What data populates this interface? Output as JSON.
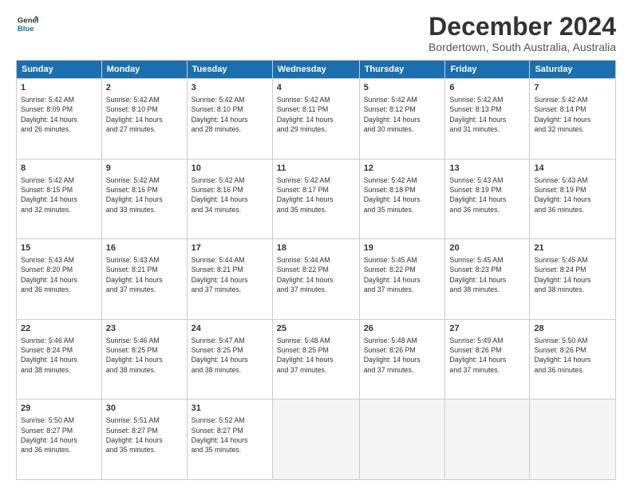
{
  "header": {
    "logo_line1": "General",
    "logo_line2": "Blue",
    "title": "December 2024",
    "subtitle": "Bordertown, South Australia, Australia"
  },
  "calendar": {
    "days_of_week": [
      "Sunday",
      "Monday",
      "Tuesday",
      "Wednesday",
      "Thursday",
      "Friday",
      "Saturday"
    ],
    "weeks": [
      [
        {
          "day": "",
          "empty": true
        },
        {
          "day": "",
          "empty": true
        },
        {
          "day": "",
          "empty": true
        },
        {
          "day": "",
          "empty": true
        },
        {
          "day": "",
          "empty": true
        },
        {
          "day": "",
          "empty": true
        },
        {
          "day": "7",
          "sunrise": "Sunrise: 5:42 AM",
          "sunset": "Sunset: 8:14 PM",
          "daylight": "Daylight: 14 hours and 32 minutes."
        }
      ],
      [
        {
          "day": "1",
          "sunrise": "Sunrise: 5:42 AM",
          "sunset": "Sunset: 8:09 PM",
          "daylight": "Daylight: 14 hours and 26 minutes."
        },
        {
          "day": "2",
          "sunrise": "Sunrise: 5:42 AM",
          "sunset": "Sunset: 8:10 PM",
          "daylight": "Daylight: 14 hours and 27 minutes."
        },
        {
          "day": "3",
          "sunrise": "Sunrise: 5:42 AM",
          "sunset": "Sunset: 8:10 PM",
          "daylight": "Daylight: 14 hours and 28 minutes."
        },
        {
          "day": "4",
          "sunrise": "Sunrise: 5:42 AM",
          "sunset": "Sunset: 8:11 PM",
          "daylight": "Daylight: 14 hours and 29 minutes."
        },
        {
          "day": "5",
          "sunrise": "Sunrise: 5:42 AM",
          "sunset": "Sunset: 8:12 PM",
          "daylight": "Daylight: 14 hours and 30 minutes."
        },
        {
          "day": "6",
          "sunrise": "Sunrise: 5:42 AM",
          "sunset": "Sunset: 8:13 PM",
          "daylight": "Daylight: 14 hours and 31 minutes."
        },
        {
          "day": "7",
          "sunrise": "Sunrise: 5:42 AM",
          "sunset": "Sunset: 8:14 PM",
          "daylight": "Daylight: 14 hours and 32 minutes."
        }
      ],
      [
        {
          "day": "8",
          "sunrise": "Sunrise: 5:42 AM",
          "sunset": "Sunset: 8:15 PM",
          "daylight": "Daylight: 14 hours and 32 minutes."
        },
        {
          "day": "9",
          "sunrise": "Sunrise: 5:42 AM",
          "sunset": "Sunset: 8:16 PM",
          "daylight": "Daylight: 14 hours and 33 minutes."
        },
        {
          "day": "10",
          "sunrise": "Sunrise: 5:42 AM",
          "sunset": "Sunset: 8:16 PM",
          "daylight": "Daylight: 14 hours and 34 minutes."
        },
        {
          "day": "11",
          "sunrise": "Sunrise: 5:42 AM",
          "sunset": "Sunset: 8:17 PM",
          "daylight": "Daylight: 14 hours and 35 minutes."
        },
        {
          "day": "12",
          "sunrise": "Sunrise: 5:42 AM",
          "sunset": "Sunset: 8:18 PM",
          "daylight": "Daylight: 14 hours and 35 minutes."
        },
        {
          "day": "13",
          "sunrise": "Sunrise: 5:43 AM",
          "sunset": "Sunset: 8:19 PM",
          "daylight": "Daylight: 14 hours and 36 minutes."
        },
        {
          "day": "14",
          "sunrise": "Sunrise: 5:43 AM",
          "sunset": "Sunset: 8:19 PM",
          "daylight": "Daylight: 14 hours and 36 minutes."
        }
      ],
      [
        {
          "day": "15",
          "sunrise": "Sunrise: 5:43 AM",
          "sunset": "Sunset: 8:20 PM",
          "daylight": "Daylight: 14 hours and 36 minutes."
        },
        {
          "day": "16",
          "sunrise": "Sunrise: 5:43 AM",
          "sunset": "Sunset: 8:21 PM",
          "daylight": "Daylight: 14 hours and 37 minutes."
        },
        {
          "day": "17",
          "sunrise": "Sunrise: 5:44 AM",
          "sunset": "Sunset: 8:21 PM",
          "daylight": "Daylight: 14 hours and 37 minutes."
        },
        {
          "day": "18",
          "sunrise": "Sunrise: 5:44 AM",
          "sunset": "Sunset: 8:22 PM",
          "daylight": "Daylight: 14 hours and 37 minutes."
        },
        {
          "day": "19",
          "sunrise": "Sunrise: 5:45 AM",
          "sunset": "Sunset: 8:22 PM",
          "daylight": "Daylight: 14 hours and 37 minutes."
        },
        {
          "day": "20",
          "sunrise": "Sunrise: 5:45 AM",
          "sunset": "Sunset: 8:23 PM",
          "daylight": "Daylight: 14 hours and 38 minutes."
        },
        {
          "day": "21",
          "sunrise": "Sunrise: 5:45 AM",
          "sunset": "Sunset: 8:24 PM",
          "daylight": "Daylight: 14 hours and 38 minutes."
        }
      ],
      [
        {
          "day": "22",
          "sunrise": "Sunrise: 5:46 AM",
          "sunset": "Sunset: 8:24 PM",
          "daylight": "Daylight: 14 hours and 38 minutes."
        },
        {
          "day": "23",
          "sunrise": "Sunrise: 5:46 AM",
          "sunset": "Sunset: 8:25 PM",
          "daylight": "Daylight: 14 hours and 38 minutes."
        },
        {
          "day": "24",
          "sunrise": "Sunrise: 5:47 AM",
          "sunset": "Sunset: 8:25 PM",
          "daylight": "Daylight: 14 hours and 38 minutes."
        },
        {
          "day": "25",
          "sunrise": "Sunrise: 5:48 AM",
          "sunset": "Sunset: 8:25 PM",
          "daylight": "Daylight: 14 hours and 37 minutes."
        },
        {
          "day": "26",
          "sunrise": "Sunrise: 5:48 AM",
          "sunset": "Sunset: 8:26 PM",
          "daylight": "Daylight: 14 hours and 37 minutes."
        },
        {
          "day": "27",
          "sunrise": "Sunrise: 5:49 AM",
          "sunset": "Sunset: 8:26 PM",
          "daylight": "Daylight: 14 hours and 37 minutes."
        },
        {
          "day": "28",
          "sunrise": "Sunrise: 5:50 AM",
          "sunset": "Sunset: 8:26 PM",
          "daylight": "Daylight: 14 hours and 36 minutes."
        }
      ],
      [
        {
          "day": "29",
          "sunrise": "Sunrise: 5:50 AM",
          "sunset": "Sunset: 8:27 PM",
          "daylight": "Daylight: 14 hours and 36 minutes."
        },
        {
          "day": "30",
          "sunrise": "Sunrise: 5:51 AM",
          "sunset": "Sunset: 8:27 PM",
          "daylight": "Daylight: 14 hours and 35 minutes."
        },
        {
          "day": "31",
          "sunrise": "Sunrise: 5:52 AM",
          "sunset": "Sunset: 8:27 PM",
          "daylight": "Daylight: 14 hours and 35 minutes."
        },
        {
          "day": "",
          "empty": true
        },
        {
          "day": "",
          "empty": true
        },
        {
          "day": "",
          "empty": true
        },
        {
          "day": "",
          "empty": true
        }
      ]
    ]
  }
}
